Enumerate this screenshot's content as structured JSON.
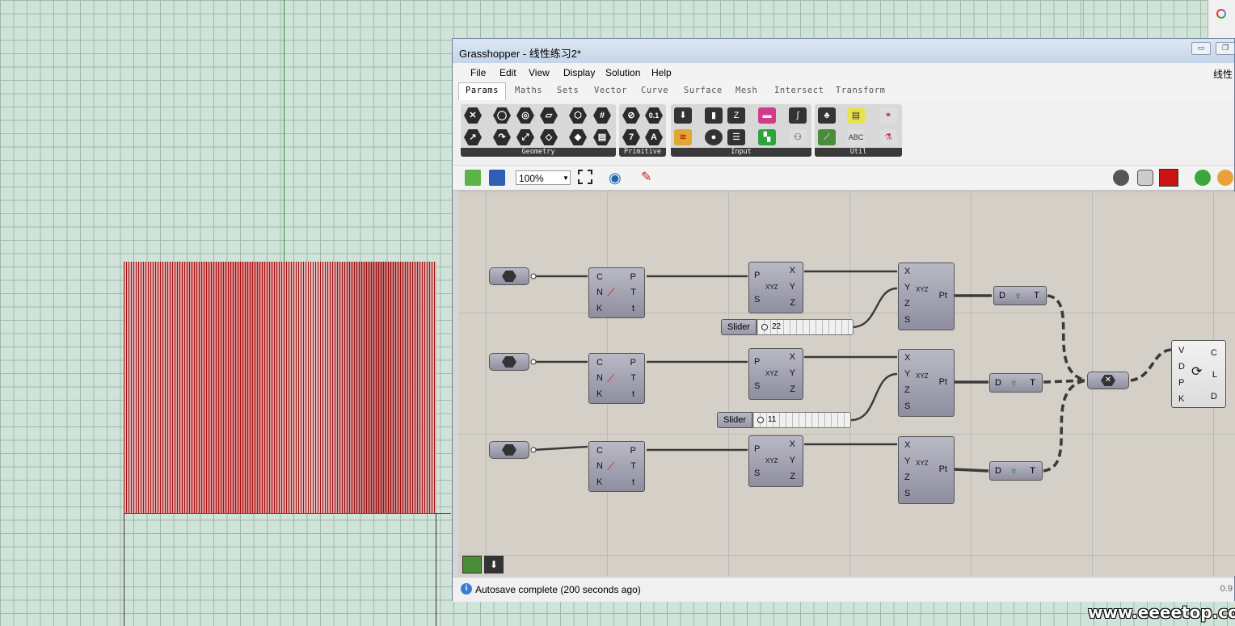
{
  "window": {
    "title": "Grasshopper - 线性练习2*",
    "min_label": "▭",
    "restore_label": "❐"
  },
  "menu": {
    "items": [
      "File",
      "Edit",
      "View",
      "Display",
      "Solution",
      "Help"
    ],
    "right_label": "线性"
  },
  "tabs": [
    "Params",
    "Maths",
    "Sets",
    "Vector",
    "Curve",
    "Surface",
    "Mesh",
    "Intersect",
    "Transform"
  ],
  "ribbon": {
    "groups": [
      "Geometry",
      "Primitive",
      "Input",
      "Util"
    ],
    "primitive_labels": [
      "0.1",
      "7",
      "A"
    ]
  },
  "toolbar": {
    "zoom": "100%"
  },
  "canvas": {
    "sliders": [
      {
        "label": "Slider",
        "value": "22"
      },
      {
        "label": "Slider",
        "value": "11"
      }
    ],
    "divide_ports_in": [
      "C",
      "N",
      "K"
    ],
    "divide_ports_out": [
      "P",
      "T",
      "t"
    ],
    "decompose_ports_in": [
      "P",
      "S"
    ],
    "decompose_ports_out": [
      "X",
      "Y",
      "Z"
    ],
    "decompose_center": "XYZ",
    "construct_ports_in": [
      "X",
      "Y",
      "Z",
      "S"
    ],
    "construct_port_out": "Pt",
    "construct_center": "XYZ",
    "graft_in": "D",
    "graft_out": "T",
    "loft_ports_in": [
      "V",
      "D",
      "P",
      "K"
    ],
    "loft_ports_out": [
      "C",
      "L",
      "D"
    ]
  },
  "status": {
    "text": "Autosave complete (200 seconds ago)",
    "right": "0.9"
  },
  "watermark": "www.eeeetop.com",
  "colors": {
    "curves": "#a31515",
    "axis_green": "#2f9a3a",
    "canvas": "#d4d0c8"
  }
}
